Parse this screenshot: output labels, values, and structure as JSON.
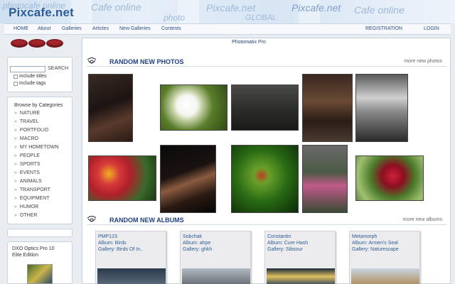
{
  "banner": {
    "logo": "Pixcafe.net",
    "words": [
      "photocafe online",
      "Cafe online",
      "Pixcafe.net",
      "GLOBAL",
      "Pixcafe.net",
      "Cafe online",
      "photo"
    ]
  },
  "nav": {
    "items": [
      "HOME",
      "About",
      "Galleries",
      "Articles",
      "New Galleries",
      "Contests"
    ],
    "right": [
      "REGISTRATION",
      "LOGIN"
    ]
  },
  "sidebar": {
    "search_button": "SEARCH",
    "include_titles": "include titles",
    "include_tags": "include tags",
    "categories_title": "Browse by Categories",
    "categories": [
      "NATURE",
      "TRAVEL",
      "PORTFOLIO",
      "MACRO",
      "MY HOMETOWN",
      "PEOPLE",
      "SPORTS",
      "EVENTS",
      "ANIMALS",
      "TRANSPORT",
      "EQUIPMENT",
      "HUMOR",
      "OTHER"
    ],
    "promo": "DXO Optics Pro 10 Elite Edition"
  },
  "main": {
    "ad_title": "Photomatix Pro",
    "new_photos": {
      "title": "RANDOM NEW PHOTOS",
      "more": "more new photos"
    },
    "new_albums": {
      "title": "RANDOM NEW ALBUMS",
      "more": "more new albums"
    }
  },
  "albums": [
    {
      "user": "PMP123",
      "album": "Album: Birds",
      "gallery": "Gallery: Birds Of In.."
    },
    {
      "user": "Sobchak",
      "album": "Album: ahpe",
      "gallery": "Gallery: ghkh"
    },
    {
      "user": "Constantin",
      "album": "Album: Cure Hash",
      "gallery": "Gallery: Sibsour"
    },
    {
      "user": "Metamorph",
      "album": "Album: Armen's Seal",
      "gallery": "Gallery: Naturescape"
    }
  ],
  "colors": {
    "accent": "#1f3f80",
    "link": "#2d5d96",
    "dots": "#a3242b"
  }
}
